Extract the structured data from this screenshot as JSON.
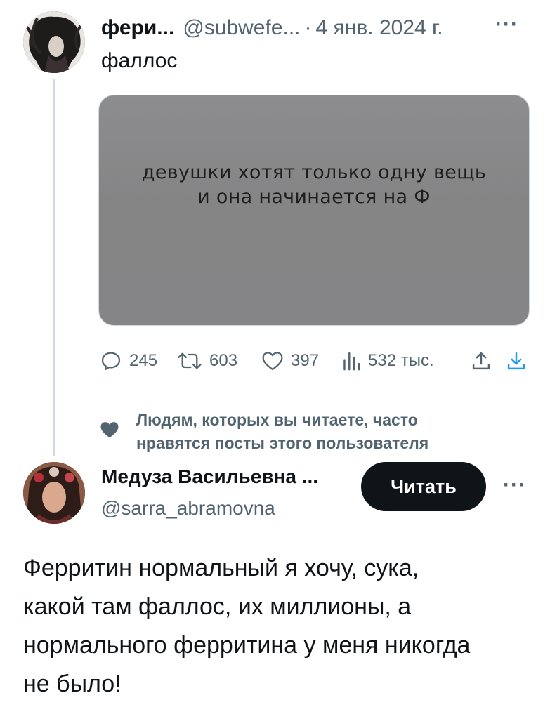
{
  "tweet": {
    "author_name": "фери...",
    "author_handle": "@subwefe...",
    "separator": "·",
    "date": "4 янв. 2024 г.",
    "more": "···",
    "text": "фаллос",
    "image_caption": [
      "девушки хотят только одну вещь",
      "и она начинается на Ф"
    ],
    "actions": {
      "replies": "245",
      "retweets": "603",
      "likes": "397",
      "views": "532 тыс."
    }
  },
  "social_context": {
    "lines": [
      "Людям, которых вы читаете, часто",
      "нравятся посты этого пользователя"
    ]
  },
  "suggested_user": {
    "name": "Медуза Васильевна ...",
    "handle": "@sarra_abramovna",
    "follow_label": "Читать",
    "more": "···",
    "bio_lines": [
      "Ферритин нормальный я хочу, сука,",
      "какой там фаллос, их миллионы, а",
      "нормального ферритина у меня никогда",
      "не было!"
    ]
  },
  "colors": {
    "text": "#0f1419",
    "secondary": "#536471",
    "line": "#cfd9de",
    "button": "#0f1419"
  },
  "icons": [
    "reply-icon",
    "retweet-icon",
    "like-icon",
    "views-icon",
    "share-icon",
    "bookmark-download-icon",
    "heart-icon",
    "more-icon"
  ]
}
